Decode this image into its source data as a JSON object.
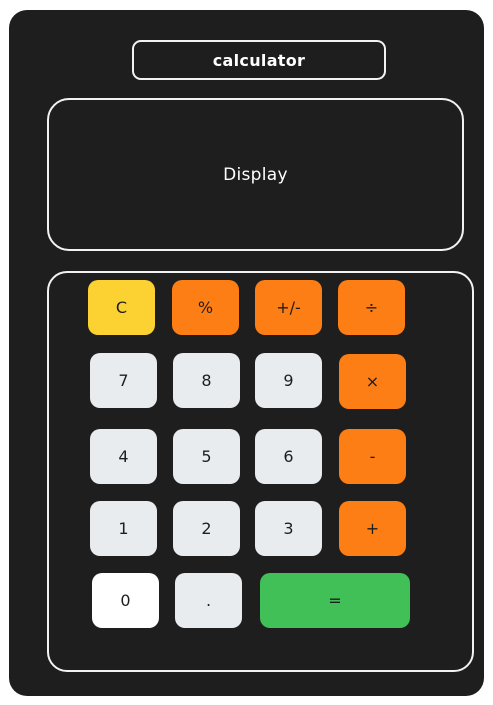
{
  "app": {
    "title": "calculator",
    "display_text": "Display"
  },
  "keys": {
    "clear": "C",
    "percent": "%",
    "sign": "+/-",
    "divide": "÷",
    "seven": "7",
    "eight": "8",
    "nine": "9",
    "multiply": "×",
    "four": "4",
    "five": "5",
    "six": "6",
    "subtract": "-",
    "one": "1",
    "two": "2",
    "three": "3",
    "add": "+",
    "zero": "0",
    "decimal": ".",
    "equals": "="
  },
  "colors": {
    "body": "#1e1e1e",
    "outline": "#f2f2f2",
    "clear_key": "#fcd232",
    "operator_key": "#fd7e14",
    "digit_key": "#e9ecef",
    "zero_key": "#ffffff",
    "equals_key": "#40c057"
  }
}
